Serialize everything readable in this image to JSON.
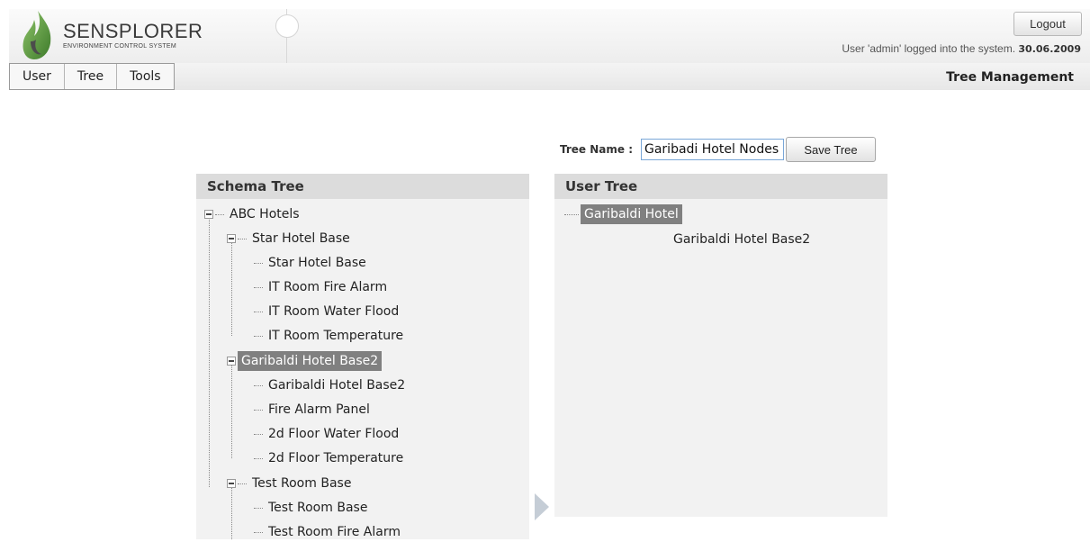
{
  "header": {
    "logo_title": "SENSPLORER",
    "logo_subtitle": "ENVIRONMENT CONTROL SYSTEM",
    "logout_label": "Logout",
    "login_text": "User 'admin' logged into the system.",
    "login_date": "30.06.2009",
    "page_title": "Tree Management"
  },
  "menu": {
    "items": [
      "User",
      "Tree",
      "Tools"
    ]
  },
  "tree_name": {
    "label": "Tree Name :",
    "value": "Garibadi Hotel Nodes",
    "save_label": "Save Tree"
  },
  "schema_tree": {
    "title": "Schema Tree",
    "nodes": [
      {
        "label": "ABC Hotels",
        "expanded": true,
        "selected": false
      },
      {
        "label": "Star Hotel Base",
        "expanded": true,
        "selected": false
      },
      {
        "label": "Star Hotel Base"
      },
      {
        "label": "IT Room Fire Alarm"
      },
      {
        "label": "IT Room Water Flood"
      },
      {
        "label": "IT Room Temperature"
      },
      {
        "label": "Garibaldi Hotel Base2",
        "expanded": true,
        "selected": true
      },
      {
        "label": "Garibaldi Hotel Base2"
      },
      {
        "label": "Fire Alarm Panel"
      },
      {
        "label": "2d Floor Water Flood"
      },
      {
        "label": "2d Floor Temperature"
      },
      {
        "label": "Test Room Base",
        "expanded": true,
        "selected": false
      },
      {
        "label": "Test Room Base"
      },
      {
        "label": "Test Room Fire Alarm"
      }
    ]
  },
  "user_tree": {
    "title": "User Tree",
    "nodes": [
      {
        "label": "Garibaldi Hotel",
        "selected": true
      },
      {
        "label": "Garibaldi Hotel Base2"
      }
    ]
  },
  "colors": {
    "selection_bg": "#808080",
    "panel_bg": "#f2f2f2",
    "panel_header_bg": "#dcdcdc",
    "logo_green": "#5a9a3c"
  }
}
